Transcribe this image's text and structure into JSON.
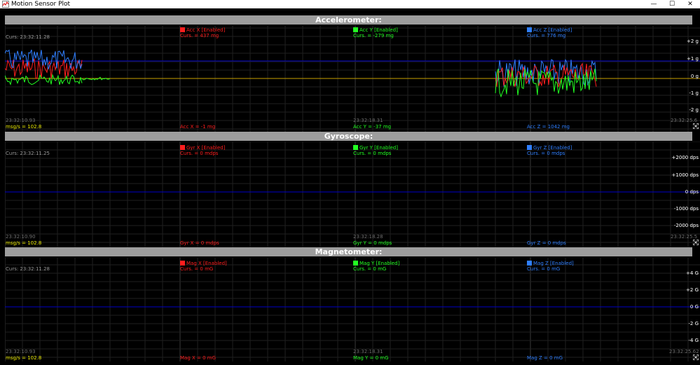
{
  "window": {
    "title": "Motion Sensor Plot"
  },
  "colors": {
    "x": "#ff1e1e",
    "y": "#22ff22",
    "z": "#2f7fff",
    "header": "#9d9d9d",
    "baseline": "#0000c8"
  },
  "panels": [
    {
      "header": "Accelerometer:",
      "cursor_time": "Curs: 23:32:11.28",
      "x": {
        "label": "Acc X [Enabled]",
        "curs": "Curs. = 437 mg",
        "value": "Acc X = -1 mg"
      },
      "y": {
        "label": "Acc Y [Enabled]",
        "curs": "Curs. = -279 mg",
        "value": "Acc Y = -37 mg"
      },
      "z": {
        "label": "Acc Z [Enabled]",
        "curs": "Curs. = 776 mg",
        "value": "Acc Z = 1042 mg"
      },
      "axis": [
        "+2 g",
        "+1 g",
        "0 g",
        "-1 g",
        "-2 g"
      ],
      "t_left": "23:32:10.93",
      "t_mid": "23:32:18.31",
      "t_right": "23:32:25.6",
      "rate": "msg/s = 102.8"
    },
    {
      "header": "Gyroscope:",
      "cursor_time": "Curs: 23:32:11.25",
      "x": {
        "label": "Gyr X [Enabled]",
        "curs": "Curs. = 0 mdps",
        "value": "Gyr X = 0 mdps"
      },
      "y": {
        "label": "Gyr Y [Enabled]",
        "curs": "Curs. = 0 mdps",
        "value": "Gyr Y = 0 mdps"
      },
      "z": {
        "label": "Gyr Z [Enabled]",
        "curs": "Curs. = 0 mdps",
        "value": "Gyr Z = 0 mdps"
      },
      "axis": [
        "+2000 dps",
        "+1000 dps",
        "0 dps",
        "-1000 dps",
        "-2000 dps"
      ],
      "t_left": "23:32:10.90",
      "t_mid": "23:32:18.28",
      "t_right": "23:32:25.5",
      "rate": "msg/s = 102.8"
    },
    {
      "header": "Magnetometer:",
      "cursor_time": "Curs: 23:32:11.28",
      "x": {
        "label": "Mag X [Enabled]",
        "curs": "Curs. = 0 mG",
        "value": "Mag X = 0 mG"
      },
      "y": {
        "label": "Mag Y [Enabled]",
        "curs": "Curs. = 0 mG",
        "value": "Mag Y = 0 mG"
      },
      "z": {
        "label": "Mag Z [Enabled]",
        "curs": "Curs. = 0 mG",
        "value": "Mag Z = 0 mG"
      },
      "axis": [
        "+4 G",
        "+2 G",
        "0 G",
        "-2 G",
        "-4 G"
      ],
      "t_left": "23:32:10.93",
      "t_mid": "23:32:18.31",
      "t_right": "23:32:25.62",
      "rate": "msg/s = 102.8"
    }
  ]
}
